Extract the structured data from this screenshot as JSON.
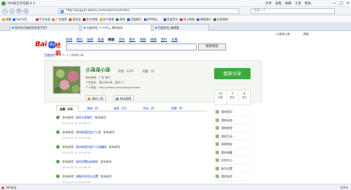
{
  "window": {
    "title": "360安全浏览器 6.3",
    "menu": [
      "文件",
      "查看",
      "收藏",
      "工具",
      "帮助"
    ],
    "controls": [
      "—",
      "□",
      "×"
    ]
  },
  "nav": {
    "url": "http://jingyan.baidu.com/user/nuc/index",
    "search_placeholder": "百度一下"
  },
  "bookmarks": [
    {
      "label": "收藏",
      "color": "#f0a020"
    },
    {
      "label": "hao123",
      "color": "#2d7bd8"
    },
    {
      "label": "今日优选",
      "color": "#e04040"
    },
    {
      "label": "广告推荐",
      "color": "#f08020"
    },
    {
      "label": "爱淘宝",
      "color": "#ff5000"
    },
    {
      "label": "京东商城",
      "color": "#c81623"
    },
    {
      "label": "苏宁易购",
      "color": "#f5a623"
    },
    {
      "label": "经验",
      "color": "#3a8a3a"
    },
    {
      "label": "百度图片",
      "color": "#2b66d9"
    },
    {
      "label": "DIY网站",
      "color": "#6a6ad0"
    },
    {
      "label": "百度音乐",
      "color": "#2b66d9"
    },
    {
      "label": "网上购物",
      "color": "#e04040"
    },
    {
      "label": "携程旅行",
      "color": "#2d7bd8"
    },
    {
      "label": "在线游戏",
      "color": "#3a8a3a"
    }
  ],
  "tabs": [
    {
      "label": "如何在百度经验发表手机?",
      "active": false
    },
    {
      "label": "百度经验_个人中心_我的经验",
      "active": true
    },
    {
      "label": "百度经验_编辑器",
      "active": false
    }
  ],
  "page": {
    "top_links": {
      "left": "小泽泽小泽",
      "right": "帮助"
    },
    "nav_items": [
      "新闻",
      "网页",
      "贴吧",
      "知道",
      "经验",
      "音乐",
      "图片",
      "视频",
      "地图",
      "百科",
      "文库"
    ],
    "nav_current": "经验",
    "search_button": "搜索经验",
    "breadcrumb": [
      "百度经验",
      ">",
      "个人",
      ">",
      "小泽泽小泽"
    ]
  },
  "profile": {
    "name": "小泽泽小泽",
    "level_label": "声望：1270",
    "wealth_label": "财富：11",
    "location": "所在城市：广东 南宁",
    "signature": "个性签名：我与你分享，快乐人！",
    "homepage": "个人网址：http://weibo.com/yangzuixiude",
    "btn_relation": "我的人缘",
    "btn_fans": "粉丝管理"
  },
  "share_button": "我来分享",
  "stats": [
    {
      "num": "25",
      "label": "经验"
    },
    {
      "num": "1",
      "label": "粉丝"
    },
    {
      "num": "8",
      "label": "关注"
    }
  ],
  "side_menu": [
    "我的首页",
    "我的动态",
    "我的经验",
    "我的互动",
    "来帮朋友",
    "我的收藏",
    "任务中心",
    "账号设置",
    "我的私信"
  ],
  "feed_tabs": [
    {
      "label": "全部（13）",
      "on": true
    },
    {
      "label": "原创（0）",
      "on": false
    },
    {
      "label": "经验（13）",
      "on": false
    },
    {
      "label": "评论（0）",
      "on": false
    },
    {
      "label": "投票（0）",
      "on": false
    }
  ],
  "feed": [
    {
      "prefix": "发布经验",
      "link": "如何分享图片",
      "suffix": "发布成功",
      "time": "2014-01-11 10:48:14"
    },
    {
      "prefix": "发布经验",
      "link": "如何给网页加个小说",
      "suffix": "发布成功",
      "time": "2014-01-11 10:43:05"
    },
    {
      "prefix": "发布经验",
      "link": "如何给网页加个小说编码",
      "suffix": "发布成功",
      "time": "2014-01-11 10:40:45"
    },
    {
      "prefix": "发布经验",
      "link": "如何设置自动保存",
      "suffix": "发布成功",
      "time": "2014-01-11 10:38:30"
    },
    {
      "prefix": "发布经验",
      "link": "电脑开机怎么设置",
      "suffix": "发布成功",
      "time": "2014-01-11 10:30:12"
    }
  ],
  "statusbar": {
    "left": "360安全",
    "right": "100%"
  }
}
